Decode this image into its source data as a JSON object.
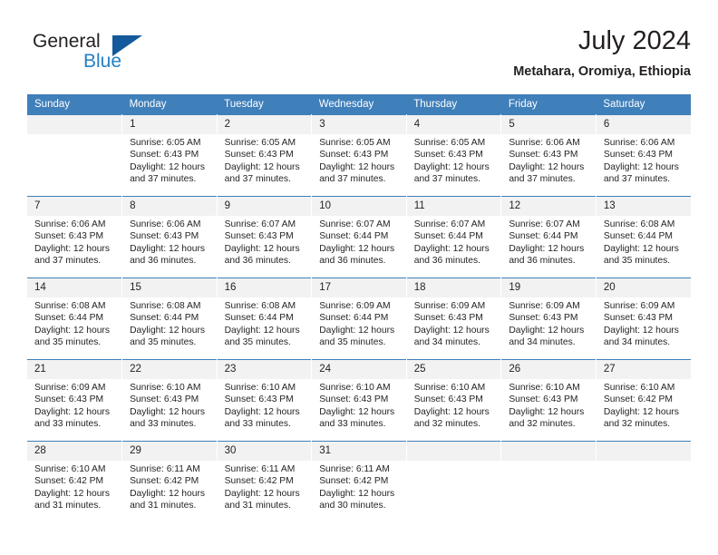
{
  "brand": {
    "word1": "General",
    "word2": "Blue",
    "logo_icon": "triangle-logo-icon",
    "blue": "#2280c4",
    "dark_blue": "#14599b"
  },
  "header": {
    "title": "July 2024",
    "subtitle": "Metahara, Oromiya, Ethiopia"
  },
  "theme": {
    "header_row_bg": "#3f7fba",
    "daynum_bg": "#f2f2f2",
    "text": "#231f20"
  },
  "weekdays": [
    "Sunday",
    "Monday",
    "Tuesday",
    "Wednesday",
    "Thursday",
    "Friday",
    "Saturday"
  ],
  "weeks": [
    [
      {
        "day": "",
        "sunrise": "",
        "sunset": "",
        "daylight1": "",
        "daylight2": ""
      },
      {
        "day": "1",
        "sunrise": "Sunrise: 6:05 AM",
        "sunset": "Sunset: 6:43 PM",
        "daylight1": "Daylight: 12 hours",
        "daylight2": "and 37 minutes."
      },
      {
        "day": "2",
        "sunrise": "Sunrise: 6:05 AM",
        "sunset": "Sunset: 6:43 PM",
        "daylight1": "Daylight: 12 hours",
        "daylight2": "and 37 minutes."
      },
      {
        "day": "3",
        "sunrise": "Sunrise: 6:05 AM",
        "sunset": "Sunset: 6:43 PM",
        "daylight1": "Daylight: 12 hours",
        "daylight2": "and 37 minutes."
      },
      {
        "day": "4",
        "sunrise": "Sunrise: 6:05 AM",
        "sunset": "Sunset: 6:43 PM",
        "daylight1": "Daylight: 12 hours",
        "daylight2": "and 37 minutes."
      },
      {
        "day": "5",
        "sunrise": "Sunrise: 6:06 AM",
        "sunset": "Sunset: 6:43 PM",
        "daylight1": "Daylight: 12 hours",
        "daylight2": "and 37 minutes."
      },
      {
        "day": "6",
        "sunrise": "Sunrise: 6:06 AM",
        "sunset": "Sunset: 6:43 PM",
        "daylight1": "Daylight: 12 hours",
        "daylight2": "and 37 minutes."
      }
    ],
    [
      {
        "day": "7",
        "sunrise": "Sunrise: 6:06 AM",
        "sunset": "Sunset: 6:43 PM",
        "daylight1": "Daylight: 12 hours",
        "daylight2": "and 37 minutes."
      },
      {
        "day": "8",
        "sunrise": "Sunrise: 6:06 AM",
        "sunset": "Sunset: 6:43 PM",
        "daylight1": "Daylight: 12 hours",
        "daylight2": "and 36 minutes."
      },
      {
        "day": "9",
        "sunrise": "Sunrise: 6:07 AM",
        "sunset": "Sunset: 6:43 PM",
        "daylight1": "Daylight: 12 hours",
        "daylight2": "and 36 minutes."
      },
      {
        "day": "10",
        "sunrise": "Sunrise: 6:07 AM",
        "sunset": "Sunset: 6:44 PM",
        "daylight1": "Daylight: 12 hours",
        "daylight2": "and 36 minutes."
      },
      {
        "day": "11",
        "sunrise": "Sunrise: 6:07 AM",
        "sunset": "Sunset: 6:44 PM",
        "daylight1": "Daylight: 12 hours",
        "daylight2": "and 36 minutes."
      },
      {
        "day": "12",
        "sunrise": "Sunrise: 6:07 AM",
        "sunset": "Sunset: 6:44 PM",
        "daylight1": "Daylight: 12 hours",
        "daylight2": "and 36 minutes."
      },
      {
        "day": "13",
        "sunrise": "Sunrise: 6:08 AM",
        "sunset": "Sunset: 6:44 PM",
        "daylight1": "Daylight: 12 hours",
        "daylight2": "and 35 minutes."
      }
    ],
    [
      {
        "day": "14",
        "sunrise": "Sunrise: 6:08 AM",
        "sunset": "Sunset: 6:44 PM",
        "daylight1": "Daylight: 12 hours",
        "daylight2": "and 35 minutes."
      },
      {
        "day": "15",
        "sunrise": "Sunrise: 6:08 AM",
        "sunset": "Sunset: 6:44 PM",
        "daylight1": "Daylight: 12 hours",
        "daylight2": "and 35 minutes."
      },
      {
        "day": "16",
        "sunrise": "Sunrise: 6:08 AM",
        "sunset": "Sunset: 6:44 PM",
        "daylight1": "Daylight: 12 hours",
        "daylight2": "and 35 minutes."
      },
      {
        "day": "17",
        "sunrise": "Sunrise: 6:09 AM",
        "sunset": "Sunset: 6:44 PM",
        "daylight1": "Daylight: 12 hours",
        "daylight2": "and 35 minutes."
      },
      {
        "day": "18",
        "sunrise": "Sunrise: 6:09 AM",
        "sunset": "Sunset: 6:43 PM",
        "daylight1": "Daylight: 12 hours",
        "daylight2": "and 34 minutes."
      },
      {
        "day": "19",
        "sunrise": "Sunrise: 6:09 AM",
        "sunset": "Sunset: 6:43 PM",
        "daylight1": "Daylight: 12 hours",
        "daylight2": "and 34 minutes."
      },
      {
        "day": "20",
        "sunrise": "Sunrise: 6:09 AM",
        "sunset": "Sunset: 6:43 PM",
        "daylight1": "Daylight: 12 hours",
        "daylight2": "and 34 minutes."
      }
    ],
    [
      {
        "day": "21",
        "sunrise": "Sunrise: 6:09 AM",
        "sunset": "Sunset: 6:43 PM",
        "daylight1": "Daylight: 12 hours",
        "daylight2": "and 33 minutes."
      },
      {
        "day": "22",
        "sunrise": "Sunrise: 6:10 AM",
        "sunset": "Sunset: 6:43 PM",
        "daylight1": "Daylight: 12 hours",
        "daylight2": "and 33 minutes."
      },
      {
        "day": "23",
        "sunrise": "Sunrise: 6:10 AM",
        "sunset": "Sunset: 6:43 PM",
        "daylight1": "Daylight: 12 hours",
        "daylight2": "and 33 minutes."
      },
      {
        "day": "24",
        "sunrise": "Sunrise: 6:10 AM",
        "sunset": "Sunset: 6:43 PM",
        "daylight1": "Daylight: 12 hours",
        "daylight2": "and 33 minutes."
      },
      {
        "day": "25",
        "sunrise": "Sunrise: 6:10 AM",
        "sunset": "Sunset: 6:43 PM",
        "daylight1": "Daylight: 12 hours",
        "daylight2": "and 32 minutes."
      },
      {
        "day": "26",
        "sunrise": "Sunrise: 6:10 AM",
        "sunset": "Sunset: 6:43 PM",
        "daylight1": "Daylight: 12 hours",
        "daylight2": "and 32 minutes."
      },
      {
        "day": "27",
        "sunrise": "Sunrise: 6:10 AM",
        "sunset": "Sunset: 6:42 PM",
        "daylight1": "Daylight: 12 hours",
        "daylight2": "and 32 minutes."
      }
    ],
    [
      {
        "day": "28",
        "sunrise": "Sunrise: 6:10 AM",
        "sunset": "Sunset: 6:42 PM",
        "daylight1": "Daylight: 12 hours",
        "daylight2": "and 31 minutes."
      },
      {
        "day": "29",
        "sunrise": "Sunrise: 6:11 AM",
        "sunset": "Sunset: 6:42 PM",
        "daylight1": "Daylight: 12 hours",
        "daylight2": "and 31 minutes."
      },
      {
        "day": "30",
        "sunrise": "Sunrise: 6:11 AM",
        "sunset": "Sunset: 6:42 PM",
        "daylight1": "Daylight: 12 hours",
        "daylight2": "and 31 minutes."
      },
      {
        "day": "31",
        "sunrise": "Sunrise: 6:11 AM",
        "sunset": "Sunset: 6:42 PM",
        "daylight1": "Daylight: 12 hours",
        "daylight2": "and 30 minutes."
      },
      {
        "day": "",
        "sunrise": "",
        "sunset": "",
        "daylight1": "",
        "daylight2": ""
      },
      {
        "day": "",
        "sunrise": "",
        "sunset": "",
        "daylight1": "",
        "daylight2": ""
      },
      {
        "day": "",
        "sunrise": "",
        "sunset": "",
        "daylight1": "",
        "daylight2": ""
      }
    ]
  ]
}
